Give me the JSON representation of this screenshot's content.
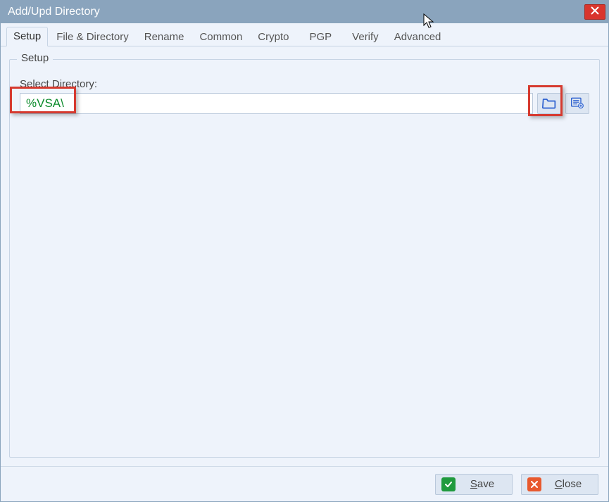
{
  "window": {
    "title": "Add/Upd Directory"
  },
  "tabs": [
    {
      "label": "Setup",
      "active": true
    },
    {
      "label": "File & Directory",
      "active": false
    },
    {
      "label": "Rename",
      "active": false
    },
    {
      "label": "Common",
      "active": false
    },
    {
      "label": "Crypto",
      "active": false
    },
    {
      "label": "PGP",
      "active": false
    },
    {
      "label": "Verify",
      "active": false
    },
    {
      "label": "Advanced",
      "active": false
    }
  ],
  "setup": {
    "group_title": "Setup",
    "field_label": "Select Directory:",
    "directory_value": "%VSA\\",
    "browse_icon": "folder-icon",
    "options_icon": "list-add-icon"
  },
  "footer": {
    "save_label": "Save",
    "close_label": "Close"
  }
}
